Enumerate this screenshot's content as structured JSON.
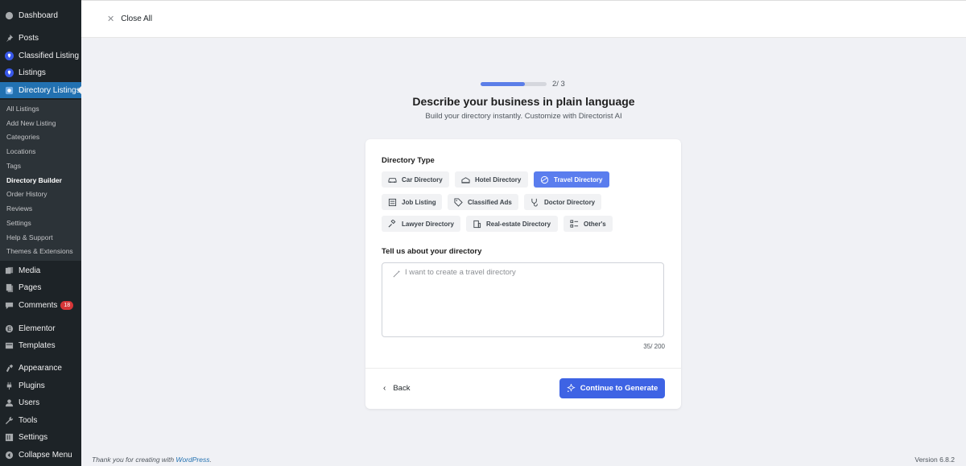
{
  "sidebar": {
    "items": [
      {
        "label": "Dashboard",
        "icon": "dashboard-icon"
      },
      {
        "label": "Posts",
        "icon": "pin-icon"
      },
      {
        "label": "Classified Listing",
        "icon": "location-pin-icon"
      },
      {
        "label": "Listings",
        "icon": "location-pin-icon"
      },
      {
        "label": "Directory Listings",
        "icon": "directory-icon"
      },
      {
        "label": "Media",
        "icon": "media-icon"
      },
      {
        "label": "Pages",
        "icon": "pages-icon"
      },
      {
        "label": "Comments",
        "icon": "comments-icon",
        "badge": "18"
      },
      {
        "label": "Elementor",
        "icon": "elementor-icon"
      },
      {
        "label": "Templates",
        "icon": "templates-icon"
      },
      {
        "label": "Appearance",
        "icon": "appearance-icon"
      },
      {
        "label": "Plugins",
        "icon": "plugins-icon"
      },
      {
        "label": "Users",
        "icon": "users-icon"
      },
      {
        "label": "Tools",
        "icon": "tools-icon"
      },
      {
        "label": "Settings",
        "icon": "settings-icon"
      },
      {
        "label": "Collapse Menu",
        "icon": "collapse-icon"
      }
    ],
    "submenu": [
      "All Listings",
      "Add New Listing",
      "Categories",
      "Locations",
      "Tags",
      "Directory Builder",
      "Order History",
      "Reviews",
      "Settings",
      "Help & Support",
      "Themes & Extensions"
    ]
  },
  "topbar": {
    "close_all": "Close All"
  },
  "wizard": {
    "step": "2/ 3",
    "progress": 0.67,
    "title": "Describe your business in plain language",
    "subtitle": "Build your directory instantly. Customize with Directorist AI",
    "directory_type_label": "Directory Type",
    "types": [
      "Car Directory",
      "Hotel Directory",
      "Travel Directory",
      "Job Listing",
      "Classified Ads",
      "Doctor Directory",
      "Lawyer Directory",
      "Real-estate Directory",
      "Other's"
    ],
    "selected_type": "Travel Directory",
    "tell_us_label": "Tell us about your directory",
    "textarea_placeholder": "I want to create a travel directory",
    "counter": "35/ 200",
    "back_label": "Back",
    "continue_label": "Continue to Generate"
  },
  "footer": {
    "thanks": "Thank you for creating with ",
    "wordpress": "WordPress",
    "period": ".",
    "version": "Version 6.8.2"
  },
  "colors": {
    "accent": "#3e63e4",
    "selected_chip": "#5a7dee",
    "sidebar_bg": "#1d2327",
    "active_menu": "#2271b1"
  }
}
